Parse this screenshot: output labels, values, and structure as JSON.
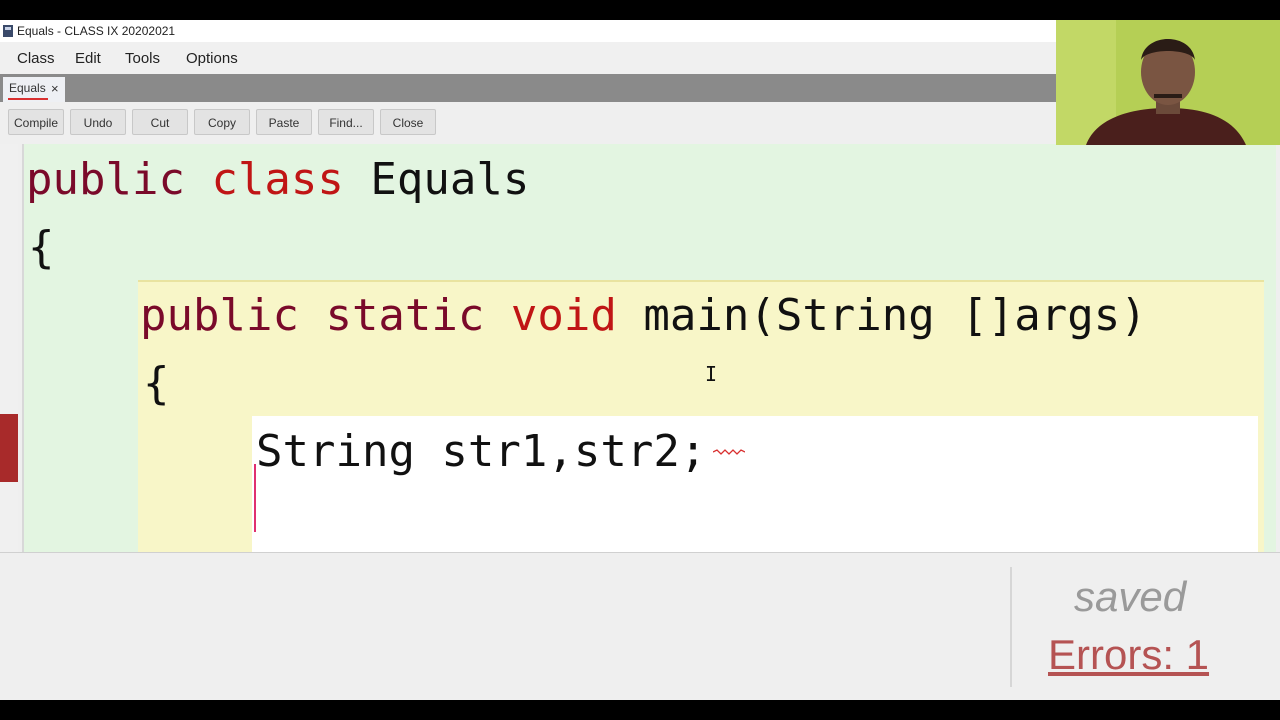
{
  "window": {
    "title": "Equals - CLASS IX 20202021"
  },
  "menubar": {
    "items": [
      "Class",
      "Edit",
      "Tools",
      "Options"
    ]
  },
  "tabs": [
    {
      "label": "Equals",
      "close_symbol": "×"
    }
  ],
  "toolbar": {
    "buttons": [
      "Compile",
      "Undo",
      "Cut",
      "Copy",
      "Paste",
      "Find...",
      "Close"
    ]
  },
  "editor": {
    "lines": {
      "l1": {
        "kw1": "public",
        "kw2": "class",
        "name": "Equals"
      },
      "l2": {
        "brace": "{"
      },
      "l3": {
        "kw1": "public",
        "kw2": "static",
        "kw3": "void",
        "rest": "main(String []args)"
      },
      "l4": {
        "brace": "{"
      },
      "l5": {
        "text": "String str1,str2;"
      }
    }
  },
  "status": {
    "saved_text": "saved",
    "errors_text": "Errors: 1"
  },
  "colors": {
    "class_scope": "#e3f5e1",
    "method_scope": "#f8f6c8",
    "keyword_dark": "#7a0a2a",
    "keyword_red": "#c01515",
    "error_marker": "#a82a2a",
    "errors_text": "#b55353"
  }
}
